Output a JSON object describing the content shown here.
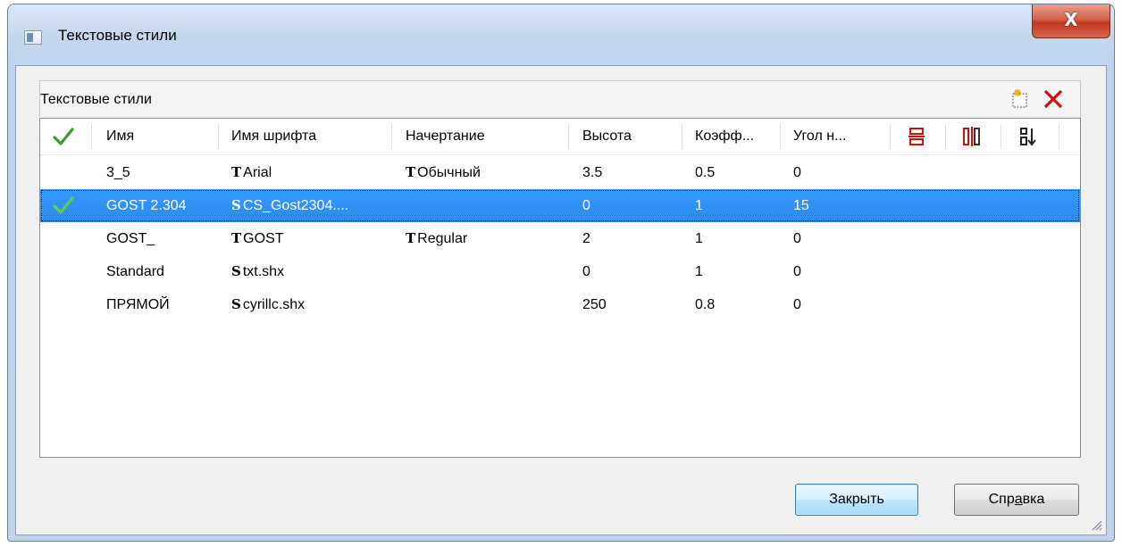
{
  "window": {
    "title": "Текстовые стили",
    "close_glyph": "X"
  },
  "panel": {
    "title": "Текстовые стили",
    "new_icon": "new-style-icon",
    "delete_icon": "delete-icon"
  },
  "table": {
    "headers": [
      "Имя",
      "Имя шрифта",
      "Начертание",
      "Высота",
      "Коэфф...",
      "Угол н..."
    ],
    "header_icons": [
      "current-check-icon",
      "text-align-icon",
      "text-width-icon",
      "text-direction-icon"
    ],
    "rows": [
      {
        "current": false,
        "name": "3_5",
        "font_type": "T",
        "font": "Arial",
        "style_type": "T",
        "style": "Обычный",
        "height": "3.5",
        "factor": "0.5",
        "angle": "0"
      },
      {
        "current": true,
        "name": "GOST 2.304",
        "font_type": "S",
        "font": "CS_Gost2304....",
        "style_type": "",
        "style": "",
        "height": "0",
        "factor": "1",
        "angle": "15"
      },
      {
        "current": false,
        "name": "GOST_",
        "font_type": "T",
        "font": "GOST",
        "style_type": "T",
        "style": "Regular",
        "height": "2",
        "factor": "1",
        "angle": "0"
      },
      {
        "current": false,
        "name": "Standard",
        "font_type": "S",
        "font": "txt.shx",
        "style_type": "",
        "style": "",
        "height": "0",
        "factor": "1",
        "angle": "0"
      },
      {
        "current": false,
        "name": "ПРЯМОЙ",
        "font_type": "S",
        "font": "cyrillc.shx",
        "style_type": "",
        "style": "",
        "height": "250",
        "factor": "0.8",
        "angle": "0"
      }
    ],
    "selected_row": 1
  },
  "buttons": {
    "close": "Закрыть",
    "help_pre": "Спр",
    "help_mnemonic": "а",
    "help_post": "вка"
  },
  "colors": {
    "selection": "#3399ff",
    "check": "#3a9a2c",
    "delete": "#cc1111"
  }
}
